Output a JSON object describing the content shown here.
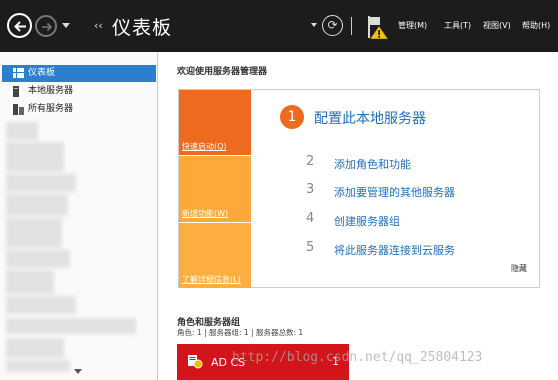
{
  "header": {
    "title": "仪表板",
    "breadcrumb_arrow": "‹‹",
    "menu": {
      "manage": "管理(M)",
      "tools": "工具(T)",
      "view": "视图(V)",
      "help": "帮助(H)"
    }
  },
  "sidebar": {
    "items": [
      {
        "label": "仪表板",
        "icon": "dashboard-icon",
        "selected": true
      },
      {
        "label": "本地服务器",
        "icon": "server-icon",
        "selected": false
      },
      {
        "label": "所有服务器",
        "icon": "servers-icon",
        "selected": false
      }
    ]
  },
  "main": {
    "welcome": "欢迎使用服务器管理器",
    "quick_start": {
      "tiles": [
        "快速启动(Q)",
        "新增功能(W)",
        "了解详细信息(L)"
      ],
      "step1": {
        "num": "1",
        "label": "配置此本地服务器"
      },
      "steps": [
        {
          "num": "2",
          "label": "添加角色和功能"
        },
        {
          "num": "3",
          "label": "添加要管理的其他服务器"
        },
        {
          "num": "4",
          "label": "创建服务器组"
        },
        {
          "num": "5",
          "label": "将此服务器连接到云服务"
        }
      ],
      "hide": "隐藏"
    },
    "roles": {
      "heading": "角色和服务器组",
      "summary": "角色: 1 | 服务器组: 1 | 服务器总数: 1",
      "tile_label": "AD CS",
      "tile_count": "1"
    }
  },
  "watermark": "http://blog.csdn.net/qq_25804123",
  "colors": {
    "titlebar": "#1c1c1c",
    "selected": "#2c7fcd",
    "orange": "#ee6a1f",
    "light_orange": "#fbaa3a",
    "link_blue": "#1f6fba",
    "role_red": "#d3141a"
  }
}
